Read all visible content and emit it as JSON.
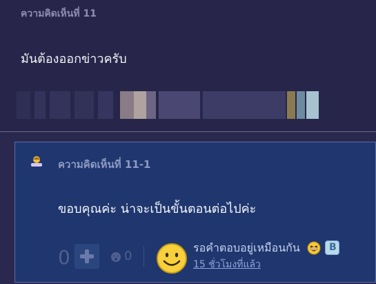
{
  "comment": {
    "number_label": "ความคิดเห็นที่ 11",
    "text": "มันต้องออกข่าวครับ"
  },
  "reply": {
    "number_label": "ความคิดเห็นที่ 11-1",
    "text": "ขอบคุณค่ะ  น่าจะเป็นขั้นตอนต่อไปค่ะ",
    "vote_count": "0",
    "emoji_reaction_count": "0",
    "author_reaction_text": "รอคำตอบอยู่เหมือนกัน",
    "timestamp": "15 ชั่วโมงที่แล้ว"
  },
  "icons": {
    "plus": "plus-icon",
    "emoji": "emoji-icon",
    "avatar": "smiley-avatar-icon",
    "laugh": "laugh-emoji-icon",
    "badge": "b-badge-icon"
  },
  "colors": {
    "background": "#27264a",
    "reply_background": "#1f376e",
    "accent_text": "#c7d3f2"
  }
}
